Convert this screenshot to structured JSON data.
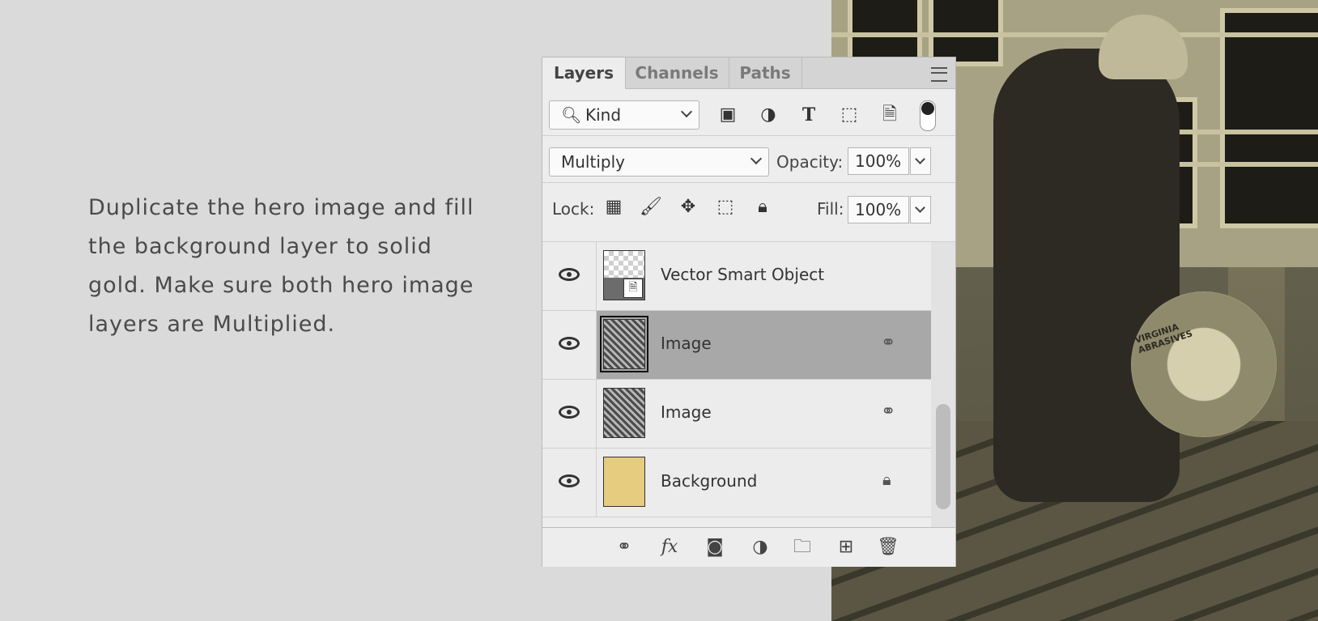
{
  "instruction": {
    "line1": "Duplicate the hero image and fill",
    "line2": "the background layer to solid",
    "line3": "gold. Make sure both hero image",
    "line4": "layers are Multiplied."
  },
  "photo": {
    "saw_brand_line1": "VIRGINIA",
    "saw_brand_line2": "ABRASIVES"
  },
  "panel": {
    "tabs": [
      {
        "label": "Layers"
      },
      {
        "label": "Channels"
      },
      {
        "label": "Paths"
      }
    ],
    "filter": {
      "kind_label": "Kind",
      "icons": [
        "image-filter-icon",
        "adjustment-filter-icon",
        "type-filter-icon",
        "shape-filter-icon",
        "smart-object-filter-icon"
      ]
    },
    "blend": {
      "mode": "Multiply",
      "opacity_label": "Opacity:",
      "opacity_value": "100%"
    },
    "lock": {
      "label": "Lock:",
      "fill_label": "Fill:",
      "fill_value": "100%"
    },
    "layers": [
      {
        "name": "Vector Smart Object",
        "type": "smart-object"
      },
      {
        "name": "Image",
        "type": "image",
        "selected": true
      },
      {
        "name": "Image",
        "type": "image"
      },
      {
        "name": "Background",
        "type": "fill",
        "color": "#e6cc7e"
      }
    ]
  },
  "colors": {
    "gold": "#e6cc7e",
    "selected_row": "#a8a8a8",
    "background": "#dadada"
  }
}
